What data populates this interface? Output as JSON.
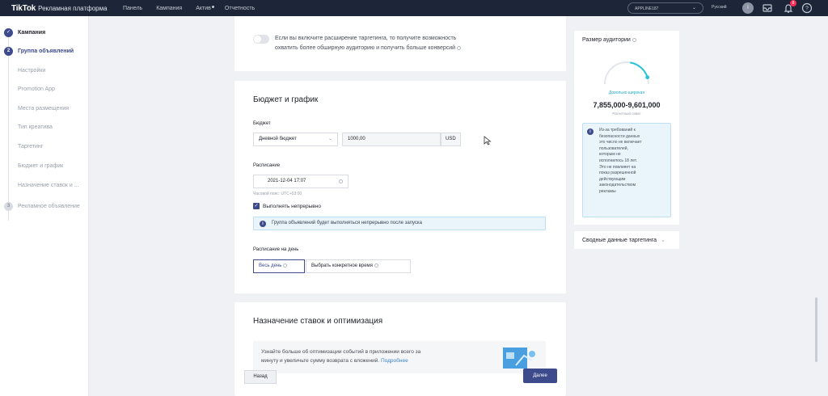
{
  "header": {
    "logo_brand": "TikTok",
    "logo_suffix": "Рекламная платформа",
    "nav": [
      "Панель",
      "Кампания",
      "Актив",
      "Отчетность"
    ],
    "account_name": "APPLINE187",
    "language": "Русский",
    "avatar_letter": "I",
    "notification_count": "8"
  },
  "sidebar": {
    "items": [
      {
        "label": "Кампания",
        "state": "done"
      },
      {
        "label": "Группа объявлений",
        "state": "active",
        "num": "2"
      },
      {
        "label": "Настройки",
        "state": "sub"
      },
      {
        "label": "Promotion App",
        "state": "sub"
      },
      {
        "label": "Места размещения",
        "state": "sub"
      },
      {
        "label": "Тип креатива",
        "state": "sub"
      },
      {
        "label": "Таргетинг",
        "state": "sub"
      },
      {
        "label": "Бюджет и график",
        "state": "sub"
      },
      {
        "label": "Назначение ставок и ...",
        "state": "sub"
      },
      {
        "label": "Рекламное объявление",
        "state": "pending",
        "num": "3"
      }
    ]
  },
  "targeting_expansion": {
    "text_line1": "Если вы включите расширение таргетинга, то получите возможность",
    "text_line2": "охватить более обширную аудиторию и получить больше конверсий"
  },
  "budget": {
    "section_title": "Бюджет и график",
    "budget_label": "Бюджет",
    "budget_type": "Дневной бюджет",
    "budget_value": "1000,00",
    "currency": "USD",
    "schedule_label": "Расписание",
    "schedule_value": "2021-12-04 17:07",
    "timezone": "Часовой пояс: UTC+03:00",
    "continuous_label": "Выполнять непрерывно",
    "continuous_checked": true,
    "info_text": "Группа объявлений будет выполняться непрерывно после запуска",
    "dayparting_label": "Расписание на день",
    "dayparting_options": [
      "Весь день",
      "Выбрать конкретное время"
    ],
    "dayparting_selected": "Весь день"
  },
  "bidding": {
    "section_title": "Назначение ставок и оптимизация",
    "promo_line1": "Узнайте больше об оптимизации событий в приложении всего за",
    "promo_line2": "минуту и увеличьте сумму возврата с вложений.",
    "promo_link": "Подробнее"
  },
  "audience": {
    "title": "Размер аудитории",
    "gauge_label": "Довольно широкая",
    "gauge_level": 0.9,
    "range": "7,855,000-9,601,000",
    "estimate_label": "Расчетный охват",
    "note_lines": [
      "Из-за требований к",
      "безопасности данных",
      "это число не включает",
      "пользователей,",
      "которым не",
      "исполнилось 18 лет.",
      "Это не повлияет на",
      "показ разрешенной",
      "действующим",
      "законодательством",
      "рекламы"
    ]
  },
  "targeting_summary": {
    "label": "Сводные данные таргетинга"
  },
  "footer": {
    "back": "Назад",
    "next": "Далее"
  },
  "colors": {
    "accent": "#3d4a8c",
    "topbar": "#1d2638",
    "gauge": "#25c4d6"
  }
}
